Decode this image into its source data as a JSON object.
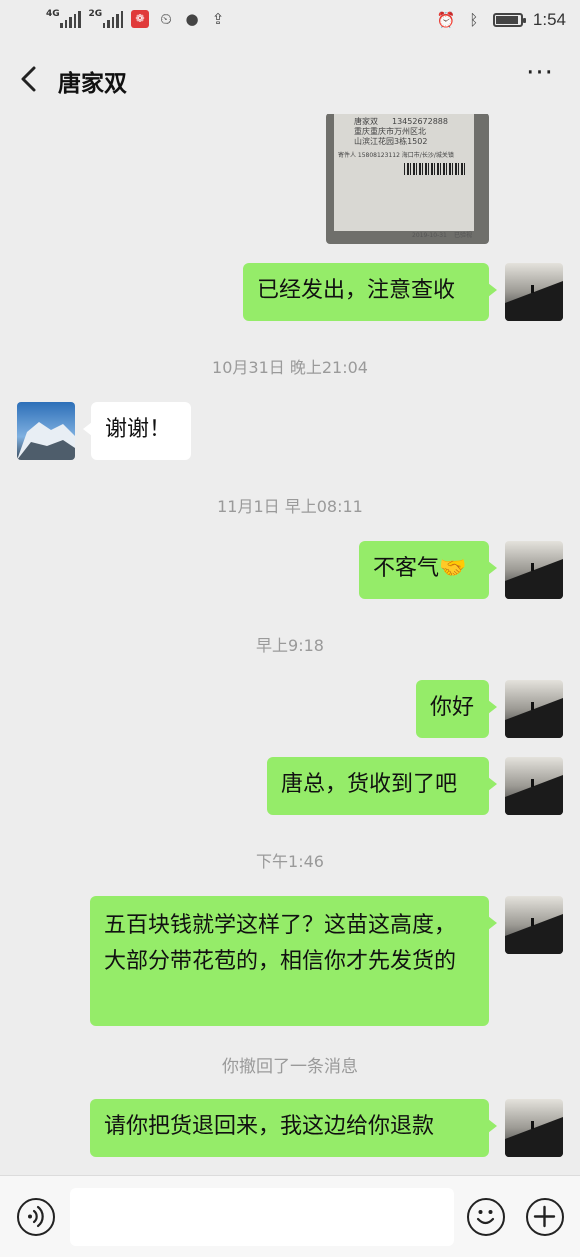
{
  "status_bar": {
    "sim1_label": "4G",
    "sim2_label": "2G",
    "time": "1:54",
    "icons": [
      "signal-icon",
      "signal-icon",
      "app-notification-icon",
      "alarm-icon",
      "chat-notification-icon",
      "upload-icon",
      "alarm-clock-icon",
      "bluetooth-icon",
      "battery-icon"
    ]
  },
  "nav": {
    "title": "唐家双"
  },
  "image_message": {
    "name": "唐家双",
    "phone": "13452672888",
    "address_1": "重庆重庆市万州区北",
    "address_2": "山滨江花园3栋1502",
    "sender_line": "寄件人 15808123112 海口市/长沙/城关镇",
    "date": "2019-10-31",
    "stamp": "已验视"
  },
  "messages": [
    {
      "type": "out",
      "text": "已经发出，注意查收"
    },
    {
      "type": "time",
      "text": "10月31日 晚上21:04"
    },
    {
      "type": "in",
      "text": "谢谢！"
    },
    {
      "type": "time",
      "text": "11月1日 早上08:11"
    },
    {
      "type": "out",
      "text": "不客气🤝"
    },
    {
      "type": "time",
      "text": "早上9:18"
    },
    {
      "type": "out",
      "text": "你好"
    },
    {
      "type": "out",
      "text": "唐总，货收到了吧"
    },
    {
      "type": "time",
      "text": "下午1:46"
    },
    {
      "type": "out",
      "text": "五百块钱就学这样了？这苗这高度，大部分带花苞的，相信你才先发货的"
    },
    {
      "type": "system",
      "text": "你撤回了一条消息"
    },
    {
      "type": "out",
      "text": "请你把货退回来，我这边给你退款"
    }
  ],
  "colors": {
    "outgoing_bubble": "#95ec69",
    "incoming_bubble": "#ffffff",
    "background": "#ededed"
  },
  "battery_level": 0.9
}
